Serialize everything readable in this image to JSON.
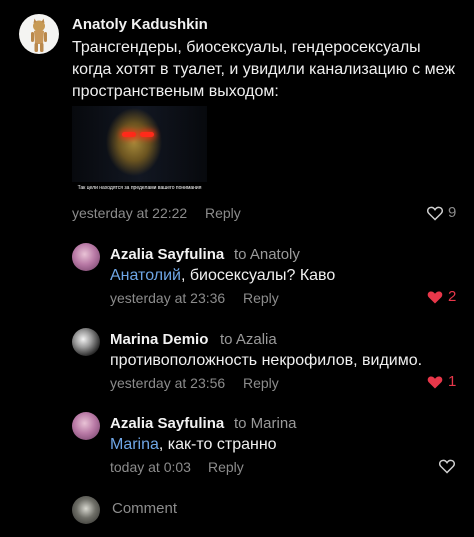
{
  "comments": [
    {
      "author": "Anatoly Kadushkin",
      "text": "Трансгендеры, биосексуалы, гендеросексуалы когда хотят в туалет, и увидили канализацию с меж пространственым выходом:",
      "image_caption": "Так цели находятся за пределами вашего понимания",
      "time": "yesterday at 22:22",
      "reply_label": "Reply",
      "likes": "9",
      "liked": false
    },
    {
      "author": "Azalia Sayfulina",
      "to": "to Anatoly",
      "mention": "Анатолий",
      "text": ", биосексуалы? Каво",
      "time": "yesterday at 23:36",
      "reply_label": "Reply",
      "likes": "2",
      "liked": true
    },
    {
      "author": "Marina Demio",
      "to": "to Azalia",
      "text": "противоположность некрофилов, видимо.",
      "time": "yesterday at 23:56",
      "reply_label": "Reply",
      "likes": "1",
      "liked": true
    },
    {
      "author": "Azalia Sayfulina",
      "to": "to Marina",
      "mention": "Marina",
      "text": ", как-то странно",
      "time": "today at 0:03",
      "reply_label": "Reply",
      "likes": "",
      "liked": false
    }
  ],
  "comment_input": {
    "placeholder": "Comment"
  },
  "colors": {
    "liked": "#e8374a",
    "mention": "#6fa6e6",
    "muted": "#8c8c8c"
  }
}
